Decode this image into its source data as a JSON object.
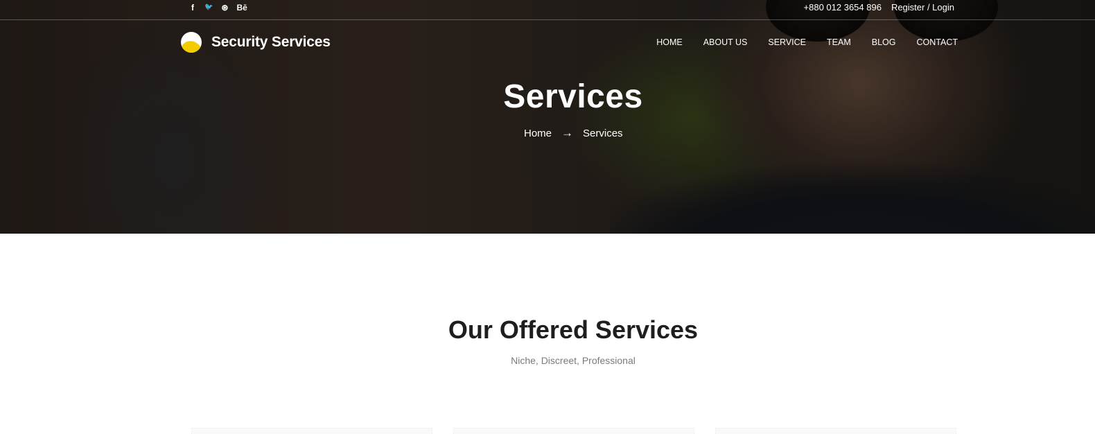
{
  "topbar": {
    "social": [
      {
        "icon": "facebook-icon",
        "glyph": "f"
      },
      {
        "icon": "twitter-icon",
        "glyph": "🐦"
      },
      {
        "icon": "dribbble-icon",
        "glyph": "⊛"
      },
      {
        "icon": "behance-icon",
        "glyph": "Bē"
      }
    ],
    "phone": "+880 012 3654 896",
    "auth": "Register / Login"
  },
  "brand": {
    "name": "Security Services",
    "logo_colors": {
      "top": "#ffffff",
      "bottom": "#f3cc00"
    }
  },
  "nav": {
    "items": [
      "HOME",
      "ABOUT US",
      "SERVICE",
      "TEAM",
      "BLOG",
      "CONTACT"
    ]
  },
  "hero": {
    "title": "Services",
    "breadcrumb": {
      "home": "Home",
      "arrow": "→",
      "current": "Services"
    }
  },
  "section": {
    "title": "Our Offered Services",
    "subtitle": "Niche, Discreet, Professional"
  },
  "colors": {
    "accent": "#f3cc00",
    "text_dark": "#1e1e1e",
    "text_muted": "#7a7a7a"
  }
}
